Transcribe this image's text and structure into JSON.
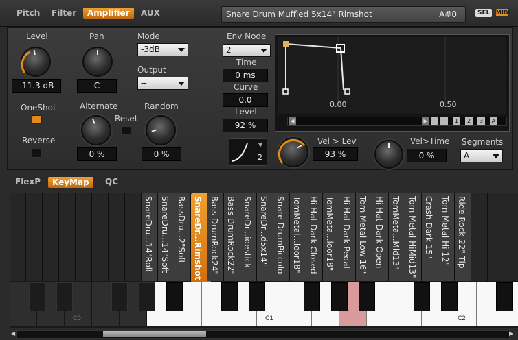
{
  "header": {
    "tabs": [
      "Pitch",
      "Filter",
      "Amplifier",
      "AUX"
    ],
    "active_tab": "Amplifier",
    "instrument_name": "Snare Drum Muffled 5x14\" Rimshot",
    "note": "A#0",
    "sel_label": "SEL",
    "midi_label": "MIDI"
  },
  "amp": {
    "level_label": "Level",
    "level_value": "-11.3 dB",
    "pan_label": "Pan",
    "pan_value": "C",
    "mode_label": "Mode",
    "mode_value": "-3dB",
    "output_label": "Output",
    "output_value": "--",
    "oneshot_label": "OneShot",
    "oneshot_on": true,
    "reverse_label": "Reverse",
    "reverse_on": false,
    "alternate_label": "Alternate",
    "alternate_value": "0 %",
    "reset_label": "Reset",
    "random_label": "Random",
    "random_value": "0 %"
  },
  "envelope": {
    "node_label": "Env Node",
    "node_value": "2",
    "time_label": "Time",
    "time_value": "0 ms",
    "curve_label": "Curve",
    "curve_value": "0.0",
    "level_label": "Level",
    "level_value": "92 %",
    "axis_labels": [
      "0.00",
      "0.50"
    ],
    "scroll_buttons": [
      "1",
      "2",
      "3",
      "A"
    ],
    "curve_number": "2",
    "vel_lev_label": "Vel > Lev",
    "vel_lev_value": "93 %",
    "vel_time_label": "Vel>Time",
    "vel_time_value": "0 %",
    "segments_label": "Segments",
    "segments_value": "A"
  },
  "lower_tabs": [
    "FlexP",
    "KeyMap",
    "QC"
  ],
  "lower_active": "KeyMap",
  "keymap": {
    "slots": [
      "SnareDru...14\"Roll",
      "SnareDru...14\"Soft",
      "BassDru...2\"Soft",
      "SnareDr...Rimshot",
      "Bass DrumRock24\"",
      "Bass DrumRock22\"",
      "SnareDr...idestick",
      "SnareDr...d5x14\"",
      "Snare DrumPiccolo",
      "TomMetal...loor18\"",
      "Hi Hat Dark Closed",
      "TomMeta...loor18\"",
      "Hi Hat Dark Pedal",
      "Tom Metal Low 16\"",
      "Hi Hat Dark Open",
      "TomMeta...Mid13\"",
      "Tom Metal HiMid13\"",
      "Crash Dark 15\"",
      "Tom Metal Hi 12\"",
      "Ride Rock 22\" Tip"
    ],
    "octave_labels": [
      "C0",
      "C1",
      "C2"
    ]
  }
}
